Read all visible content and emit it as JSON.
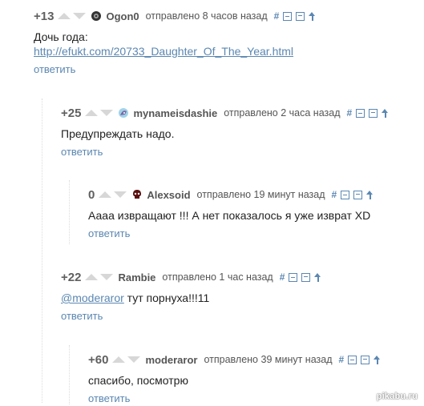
{
  "comments": [
    {
      "rating": "+13",
      "author": "Ogon0",
      "sent": "отправлено 8 часов назад",
      "text_lines": [
        "Дочь года:"
      ],
      "link": "http://efukt.com/20733_Daughter_Of_The_Year.html",
      "reply": "ответить",
      "avatar_icon": "dark-emblem-icon"
    },
    {
      "rating": "+25",
      "author": "mynameisdashie",
      "sent": "отправлено 2 часа назад",
      "text": "Предупреждать надо.",
      "reply": "ответить",
      "avatar_icon": "pony-icon"
    },
    {
      "rating": "0",
      "author": "Alexsoid",
      "sent": "отправлено 19 минут назад",
      "text": "Аааа извращают !!! А нет показалось я уже изврат XD",
      "reply": "ответить",
      "avatar_icon": "skull-icon"
    },
    {
      "rating": "+22",
      "author": "Rambie",
      "sent": "отправлено 1 час назад",
      "mention": "@moderaror",
      "text": " тут порнуха!!!11",
      "reply": "ответить"
    },
    {
      "rating": "+60",
      "author": "moderaror",
      "sent": "отправлено 39 минут назад",
      "text": "спасибо, посмотрю",
      "reply": "ответить"
    }
  ],
  "tool_hash": "#",
  "watermark": "pikabu.ru",
  "colors": {
    "link": "#5b87b2",
    "vote_arrow": "#d7d7d7",
    "rating": "#5f5f5f"
  }
}
